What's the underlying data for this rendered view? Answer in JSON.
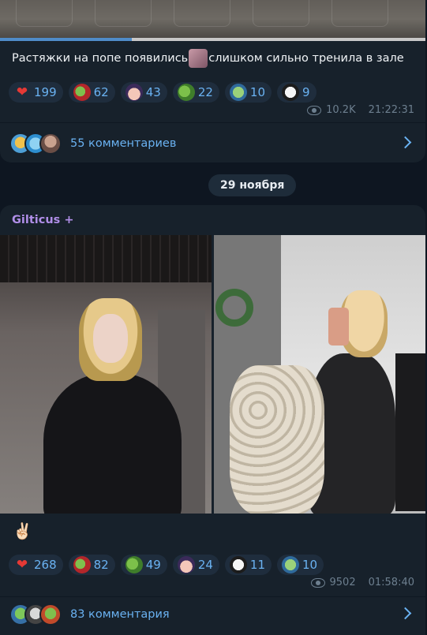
{
  "post1": {
    "caption_before": "Растяжки на попе появились",
    "caption_after": "слишком сильно тренила в зале",
    "video_progress": 0.31,
    "reactions": [
      {
        "emoji": "heart",
        "count": "199"
      },
      {
        "emoji": "frog-red",
        "count": "62"
      },
      {
        "emoji": "anime",
        "count": "43"
      },
      {
        "emoji": "frog",
        "count": "22"
      },
      {
        "emoji": "pepe-hand",
        "count": "10"
      },
      {
        "emoji": "joker",
        "count": "9"
      }
    ],
    "views": "10.2K",
    "time": "21:22:31",
    "comments_label": "55 комментариев"
  },
  "date_separator": "29 ноября",
  "post2": {
    "author": "Gilticus +",
    "text": "✌🏻",
    "reactions": [
      {
        "emoji": "heart",
        "count": "268"
      },
      {
        "emoji": "frog-red",
        "count": "82"
      },
      {
        "emoji": "frog",
        "count": "49"
      },
      {
        "emoji": "anime",
        "count": "24"
      },
      {
        "emoji": "joker",
        "count": "11"
      },
      {
        "emoji": "pepe-hand",
        "count": "10"
      }
    ],
    "views": "9502",
    "time": "01:58:40",
    "comments_label": "83 комментария"
  },
  "colors": {
    "background": "#0e1621",
    "bubble": "#17212b",
    "accent": "#6ab2f2",
    "author": "#b08ee8",
    "heart": "#e53935"
  }
}
